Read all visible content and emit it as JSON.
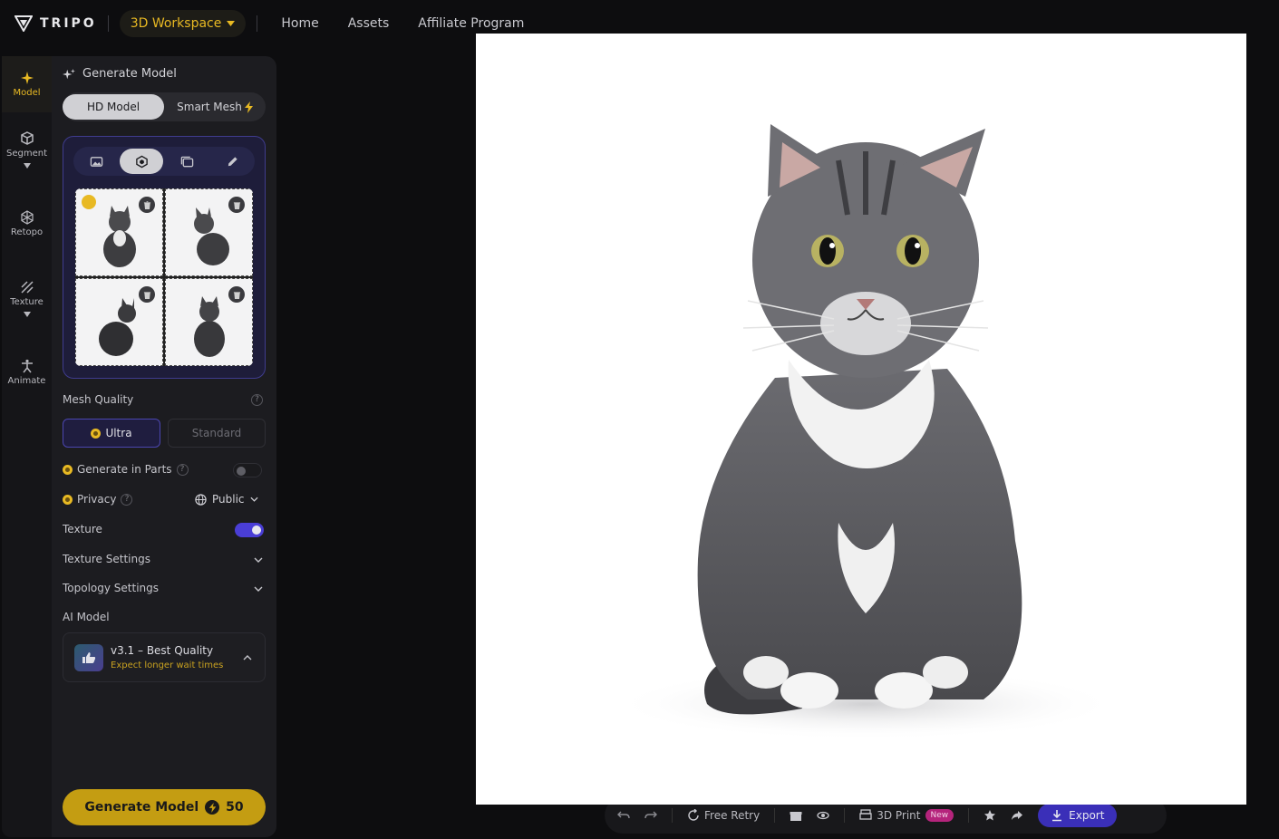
{
  "nav": {
    "brand": "TRIPO",
    "workspace": "3D Workspace",
    "links": [
      "Home",
      "Assets",
      "Affiliate Program"
    ]
  },
  "rail": {
    "items": [
      {
        "label": "Model",
        "icon": "sparkle-icon",
        "active": true
      },
      {
        "label": "Segment",
        "icon": "cube-segment-icon"
      },
      {
        "label": "Retopo",
        "icon": "mesh-icon"
      },
      {
        "label": "Texture",
        "icon": "texture-hatch-icon"
      },
      {
        "label": "Animate",
        "icon": "figure-icon"
      }
    ]
  },
  "panel": {
    "title": "Generate Model",
    "tabs": {
      "hd": "HD Model",
      "smart": "Smart Mesh"
    },
    "mesh_quality_label": "Mesh Quality",
    "quality": {
      "ultra": "Ultra",
      "standard": "Standard"
    },
    "parts_label": "Generate in Parts",
    "privacy_label": "Privacy",
    "privacy_value": "Public",
    "texture_label": "Texture",
    "texture_settings_label": "Texture Settings",
    "topology_settings_label": "Topology Settings",
    "ai_model_label": "AI Model",
    "ai_model_name": "v3.1 – Best Quality",
    "ai_model_note": "Expect longer wait times",
    "generate_label": "Generate Model",
    "generate_cost": "50"
  },
  "toolbar": {
    "free_retry": "Free Retry",
    "print": "3D Print",
    "new_badge": "New",
    "export": "Export"
  },
  "colors": {
    "accent_gold": "#e8b923",
    "accent_purple": "#4a3ed6"
  }
}
